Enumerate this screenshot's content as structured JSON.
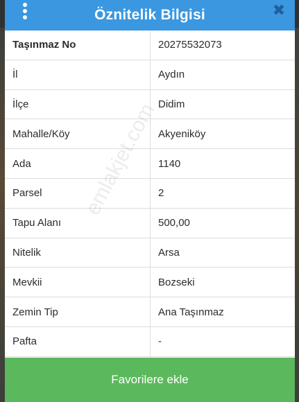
{
  "dialog": {
    "title": "Öznitelik Bilgisi",
    "close_glyph": "✖",
    "menu_icon": "kebab-menu-icon"
  },
  "attributes": [
    {
      "key": "Taşınmaz No",
      "value": "20275532073",
      "bold": true
    },
    {
      "key": "İl",
      "value": "Aydın"
    },
    {
      "key": "İlçe",
      "value": "Didim"
    },
    {
      "key": "Mahalle/Köy",
      "value": "Akyeniköy"
    },
    {
      "key": "Ada",
      "value": "1140"
    },
    {
      "key": "Parsel",
      "value": "2"
    },
    {
      "key": "Tapu Alanı",
      "value": "500,00"
    },
    {
      "key": "Nitelik",
      "value": "Arsa"
    },
    {
      "key": "Mevkii",
      "value": "Bozseki"
    },
    {
      "key": "Zemin Tip",
      "value": "Ana Taşınmaz"
    },
    {
      "key": "Pafta",
      "value": "-"
    }
  ],
  "footer": {
    "favorite_label": "Favorilere ekle"
  },
  "watermark": "emlakjet.com",
  "colors": {
    "header": "#3a97e0",
    "footer": "#5cb85c"
  }
}
